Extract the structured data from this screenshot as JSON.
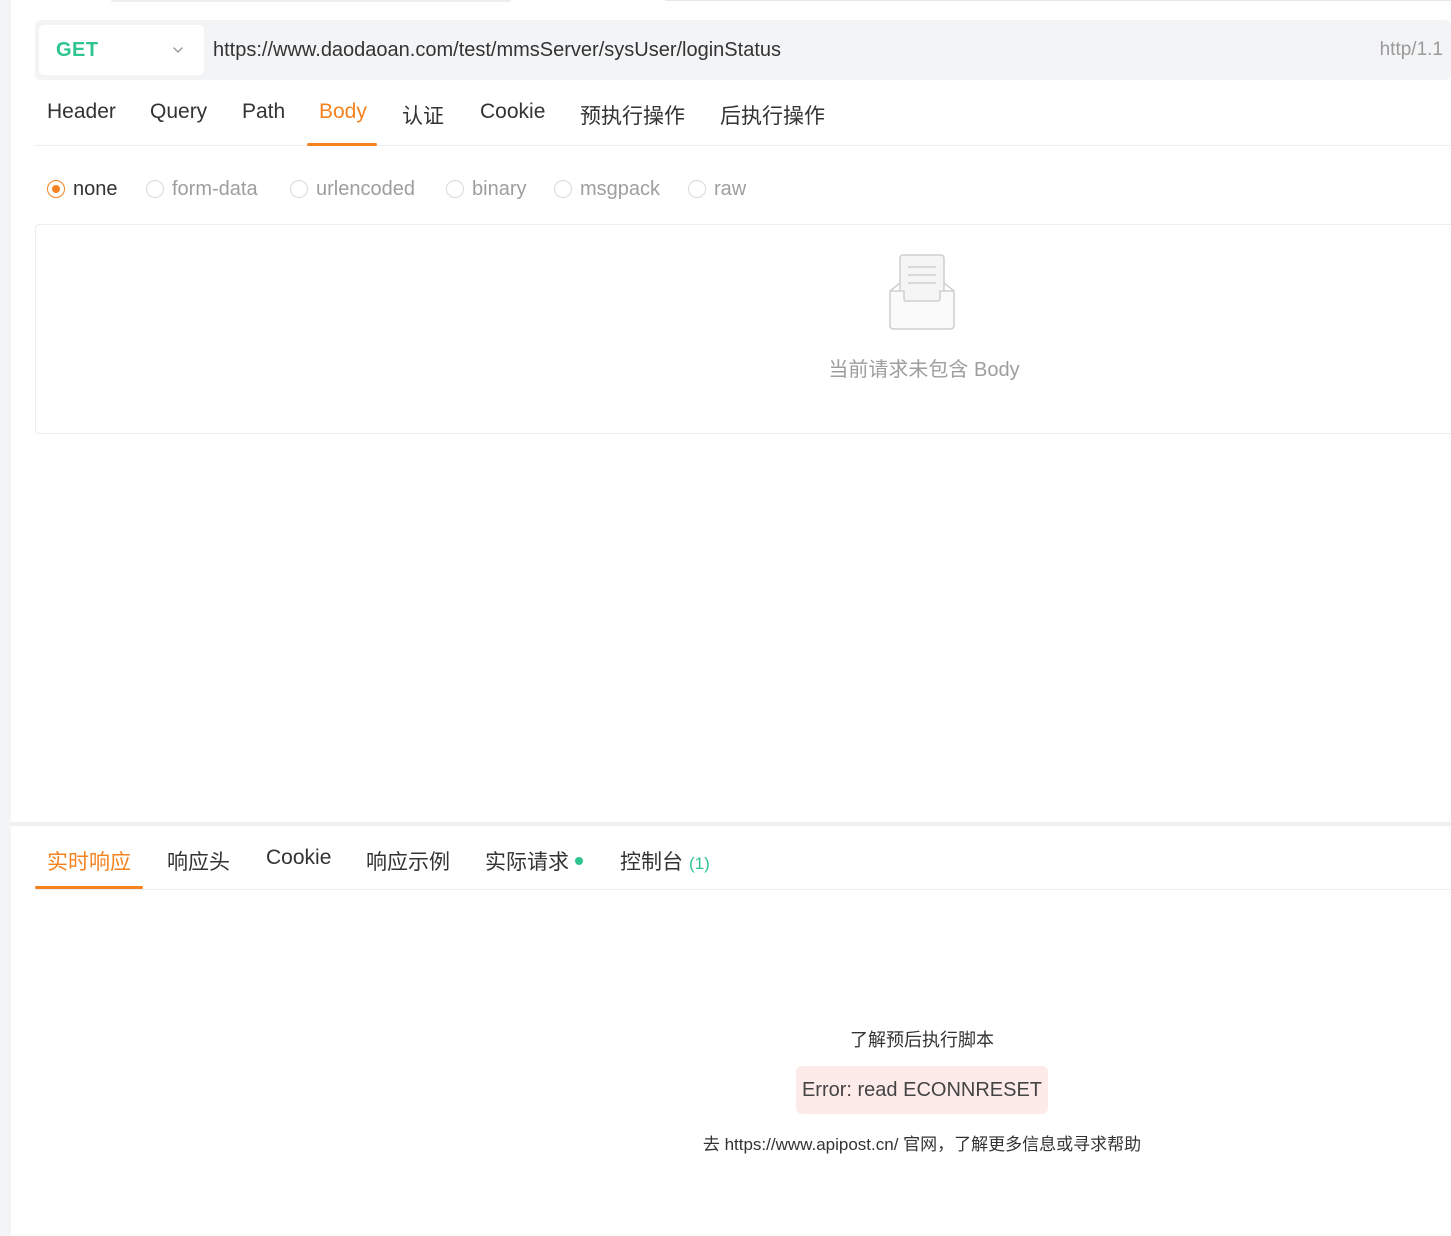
{
  "request": {
    "method": "GET",
    "url": "https://www.daodaoan.com/test/mmsServer/sysUser/loginStatus",
    "http_version": "http/1.1",
    "tabs": [
      {
        "label": "Header",
        "active": false
      },
      {
        "label": "Query",
        "active": false
      },
      {
        "label": "Path",
        "active": false
      },
      {
        "label": "Body",
        "active": true
      },
      {
        "label": "认证",
        "active": false
      },
      {
        "label": "Cookie",
        "active": false
      },
      {
        "label": "预执行操作",
        "active": false
      },
      {
        "label": "后执行操作",
        "active": false
      }
    ],
    "body_types": [
      {
        "label": "none",
        "selected": true
      },
      {
        "label": "form-data",
        "selected": false
      },
      {
        "label": "urlencoded",
        "selected": false
      },
      {
        "label": "binary",
        "selected": false
      },
      {
        "label": "msgpack",
        "selected": false
      },
      {
        "label": "raw",
        "selected": false
      }
    ],
    "empty_body_text": "当前请求未包含 Body"
  },
  "response": {
    "tabs": [
      {
        "label": "实时响应",
        "active": true
      },
      {
        "label": "响应头",
        "active": false
      },
      {
        "label": "Cookie",
        "active": false
      },
      {
        "label": "响应示例",
        "active": false
      },
      {
        "label": "实际请求",
        "active": false
      },
      {
        "label": "控制台",
        "active": false
      }
    ],
    "console_count": "(1)",
    "learn_scripts_link": "了解预后执行脚本",
    "error_message": "Error: read ECONNRESET",
    "help_prefix": "去",
    "help_url": "https://www.apipost.cn/",
    "help_suffix": "官网，了解更多信息或寻求帮助"
  },
  "colors": {
    "accent": "#f5821f",
    "method_get": "#2ec58f",
    "error_bg": "#fdebea"
  }
}
